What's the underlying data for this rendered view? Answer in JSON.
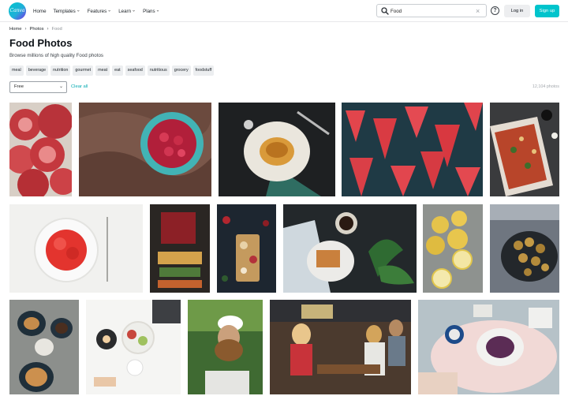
{
  "header": {
    "logo_text": "Canva",
    "nav": [
      {
        "label": "Home",
        "has_dropdown": false
      },
      {
        "label": "Templates",
        "has_dropdown": true
      },
      {
        "label": "Features",
        "has_dropdown": true
      },
      {
        "label": "Learn",
        "has_dropdown": true
      },
      {
        "label": "Plans",
        "has_dropdown": true
      }
    ],
    "search_value": "Food",
    "login_label": "Log in",
    "signup_label": "Sign up"
  },
  "breadcrumb": [
    "Home",
    "Photos",
    "Food"
  ],
  "page_title": "Food Photos",
  "page_subtitle": "Browse millions of high quality Food photos",
  "tags": [
    "meal",
    "beverage",
    "nutrition",
    "gourmet",
    "meat",
    "eat",
    "seafood",
    "nutritious",
    "grocery",
    "foodstuff"
  ],
  "filter": {
    "selected": "Free",
    "clear_label": "Clear all"
  },
  "result_count": "12,104 photos",
  "photos": [
    {
      "name": "pomegranate"
    },
    {
      "name": "raspberries-bowl"
    },
    {
      "name": "pancakes"
    },
    {
      "name": "watermelon-slices"
    },
    {
      "name": "pizza"
    },
    {
      "name": "strawberries-bowl"
    },
    {
      "name": "restaurant-storefront"
    },
    {
      "name": "charcuterie-board"
    },
    {
      "name": "waffles-coffee"
    },
    {
      "name": "lemons"
    },
    {
      "name": "falafel"
    },
    {
      "name": "pastries-coffee"
    },
    {
      "name": "brunch-table"
    },
    {
      "name": "burger-man"
    },
    {
      "name": "friends-restaurant"
    },
    {
      "name": "pie-table"
    }
  ]
}
